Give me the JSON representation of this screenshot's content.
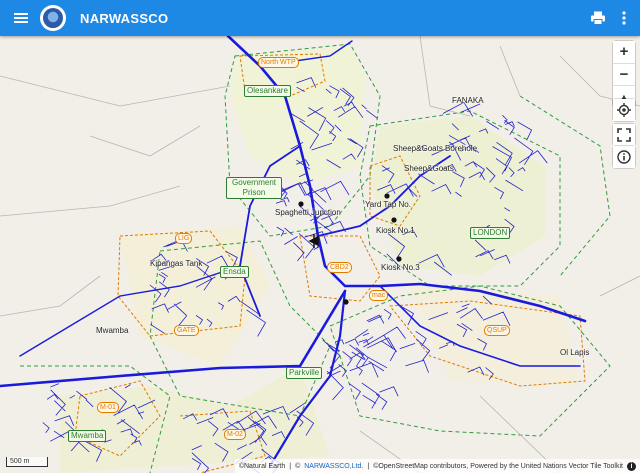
{
  "app": {
    "title": "NARWASSCO",
    "menu_icon": "menu-icon",
    "logo_icon": "narwassco-logo",
    "print_icon": "print-icon",
    "more_icon": "more-vert-icon"
  },
  "colors": {
    "appbar": "#1e88e5",
    "pipes": "#1a1adc",
    "zone_border": "#2e9d3a",
    "dma_border": "#e07b00"
  },
  "map": {
    "place_labels": {
      "fanaka": "FANAKA",
      "sheep_borehole": "Sheep&Goats Borehole",
      "sheep_goats": "Sheep&Goats",
      "yard_tap": "Yard Tap No.",
      "spaghetti": "Spaghetti Junction",
      "kiosk1": "Kiosk No.1",
      "kiosk3": "Kiosk No.3",
      "kipangas": "Kipangas Tank",
      "mwamba": "Mwamba",
      "ol_lapis": "Ol Lapis"
    },
    "zones": {
      "olesankare": "Olesankare",
      "prison": "Government Prison",
      "london": "LONDON",
      "ensda": "Ensda",
      "parkville": "Parkville",
      "mwamba_zone": "Mwamba"
    },
    "dma_tags": {
      "north_wtp": "North WTP",
      "cbd2": "CBD2",
      "gate": "GATE",
      "qsup": "QSUP",
      "m01": "M-01",
      "m02": "M-02",
      "mac": "mac",
      "tag_left": "LIG"
    }
  },
  "controls": {
    "zoom_in": "+",
    "zoom_out": "−",
    "compass": "▲",
    "geolocate_icon": "geolocate-icon",
    "fullscreen_icon": "fullscreen-icon",
    "info_icon": "info-icon"
  },
  "attribution": {
    "natural_earth": "©Natural Earth",
    "sep1": "|",
    "copyright_mark": "©",
    "narwassco": "NARWASSCO,Ltd.",
    "sep2": "|",
    "osm": "©OpenStreetMap contributors, Powered by the United Nations Vector Tile Toolkit"
  },
  "scale_bar": "500 m"
}
